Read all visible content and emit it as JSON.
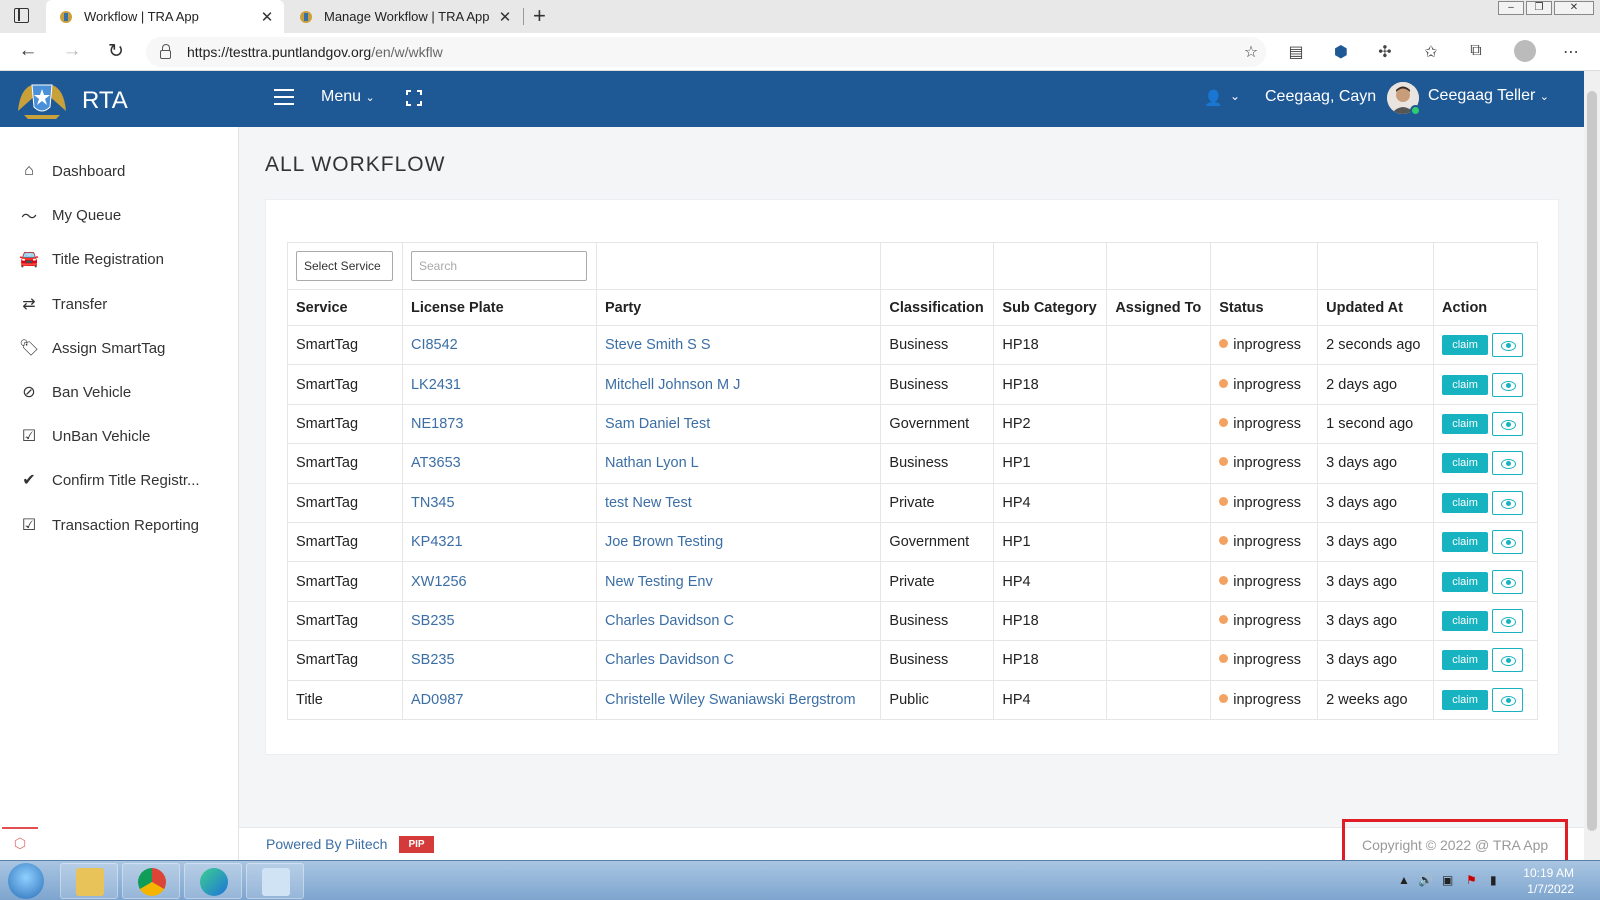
{
  "browser": {
    "tabs": [
      {
        "title": "Workflow | TRA App",
        "active": true
      },
      {
        "title": "Manage Workflow | TRA App",
        "active": false
      }
    ],
    "close_glyph": "✕",
    "new_tab_glyph": "+",
    "url_host": "https://testtra.puntlandgov.org",
    "url_path": "/en/w/wkflw"
  },
  "header": {
    "brand": "RTA",
    "menu_label": "Menu",
    "office_name": "Ceegaag, Cayn",
    "user_name": "Ceegaag Teller",
    "bg_color": "#1f5995"
  },
  "sidebar": {
    "items": [
      {
        "label": "Dashboard",
        "icon": "home-icon"
      },
      {
        "label": "My Queue",
        "icon": "trend-icon"
      },
      {
        "label": "Title Registration",
        "icon": "car-icon"
      },
      {
        "label": "Transfer",
        "icon": "exchange-icon"
      },
      {
        "label": "Assign SmartTag",
        "icon": "tags-icon"
      },
      {
        "label": "Ban Vehicle",
        "icon": "ban-icon"
      },
      {
        "label": "UnBan Vehicle",
        "icon": "check-square-icon"
      },
      {
        "label": "Confirm Title Registr...",
        "icon": "check-icon"
      },
      {
        "label": "Transaction Reporting",
        "icon": "check-square-icon"
      }
    ]
  },
  "main": {
    "page_title": "ALL WORKFLOW",
    "filters": {
      "service_select": "Select Service",
      "search_placeholder": "Search"
    },
    "table": {
      "columns": [
        "Service",
        "License Plate",
        "Party",
        "Classification",
        "Sub Category",
        "Assigned To",
        "Status",
        "Updated At",
        "Action"
      ],
      "claim_label": "claim",
      "rows": [
        {
          "service": "SmartTag",
          "plate": "CI8542",
          "party": "Steve Smith S S",
          "classification": "Business",
          "sub": "HP18",
          "assigned": "",
          "status": "inprogress",
          "updated": "2 seconds ago"
        },
        {
          "service": "SmartTag",
          "plate": "LK2431",
          "party": "Mitchell Johnson M J",
          "classification": "Business",
          "sub": "HP18",
          "assigned": "",
          "status": "inprogress",
          "updated": "2 days ago"
        },
        {
          "service": "SmartTag",
          "plate": "NE1873",
          "party": "Sam Daniel Test",
          "classification": "Government",
          "sub": "HP2",
          "assigned": "",
          "status": "inprogress",
          "updated": "1 second ago"
        },
        {
          "service": "SmartTag",
          "plate": "AT3653",
          "party": "Nathan Lyon L",
          "classification": "Business",
          "sub": "HP1",
          "assigned": "",
          "status": "inprogress",
          "updated": "3 days ago"
        },
        {
          "service": "SmartTag",
          "plate": "TN345",
          "party": "test New Test",
          "classification": "Private",
          "sub": "HP4",
          "assigned": "",
          "status": "inprogress",
          "updated": "3 days ago"
        },
        {
          "service": "SmartTag",
          "plate": "KP4321",
          "party": "Joe Brown Testing",
          "classification": "Government",
          "sub": "HP1",
          "assigned": "",
          "status": "inprogress",
          "updated": "3 days ago"
        },
        {
          "service": "SmartTag",
          "plate": "XW1256",
          "party": "New Testing Env",
          "classification": "Private",
          "sub": "HP4",
          "assigned": "",
          "status": "inprogress",
          "updated": "3 days ago"
        },
        {
          "service": "SmartTag",
          "plate": "SB235",
          "party": "Charles Davidson C",
          "classification": "Business",
          "sub": "HP18",
          "assigned": "",
          "status": "inprogress",
          "updated": "3 days ago"
        },
        {
          "service": "SmartTag",
          "plate": "SB235",
          "party": "Charles Davidson C",
          "classification": "Business",
          "sub": "HP18",
          "assigned": "",
          "status": "inprogress",
          "updated": "3 days ago"
        },
        {
          "service": "Title",
          "plate": "AD0987",
          "party": "Christelle Wiley Swaniawski Bergstrom",
          "classification": "Public",
          "sub": "HP4",
          "assigned": "",
          "status": "inprogress",
          "updated": "2 weeks ago"
        }
      ]
    }
  },
  "footer": {
    "powered_by": "Powered By Piitech",
    "logo_text": "PIP",
    "copyright": "Copyright © 2022 @ TRA App"
  },
  "taskbar": {
    "time": "10:19 AM",
    "date": "1/7/2022"
  }
}
